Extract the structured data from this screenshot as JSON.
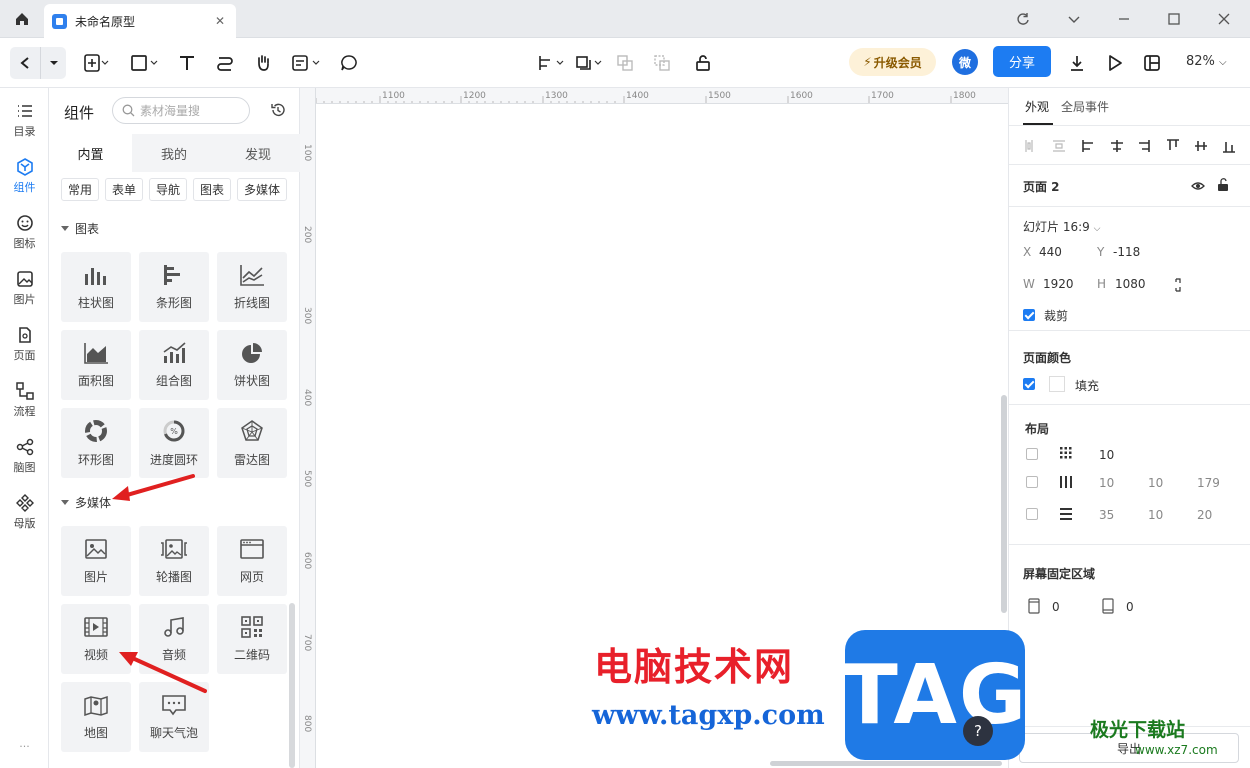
{
  "titlebar": {
    "tab_title": "未命名原型"
  },
  "toolbar": {
    "upgrade": "升级会员",
    "avatar": "微",
    "share": "分享",
    "zoom": "82%"
  },
  "rail": [
    {
      "label": "目录",
      "icon": "list-icon"
    },
    {
      "label": "组件",
      "icon": "component-icon"
    },
    {
      "label": "图标",
      "icon": "smile-icon"
    },
    {
      "label": "图片",
      "icon": "image-icon"
    },
    {
      "label": "页面",
      "icon": "page-icon"
    },
    {
      "label": "流程",
      "icon": "flow-icon"
    },
    {
      "label": "脑图",
      "icon": "mindmap-icon"
    },
    {
      "label": "母版",
      "icon": "master-icon"
    }
  ],
  "rail_more": "...",
  "panel": {
    "title": "组件",
    "search_placeholder": "素材海量搜",
    "tabs": [
      "内置",
      "我的",
      "发现"
    ],
    "chips": [
      "常用",
      "表单",
      "导航",
      "图表",
      "多媒体"
    ],
    "section_chart": "图表",
    "chart_items": [
      "柱状图",
      "条形图",
      "折线图",
      "面积图",
      "组合图",
      "饼状图",
      "环形图",
      "进度圆环",
      "雷达图"
    ],
    "section_media": "多媒体",
    "media_items": [
      "图片",
      "轮播图",
      "网页",
      "视频",
      "音频",
      "二维码",
      "地图",
      "聊天气泡"
    ]
  },
  "ruler": {
    "h": [
      "1100",
      "1200",
      "1300",
      "1400",
      "1500",
      "1600",
      "1700",
      "1800"
    ],
    "v": [
      "100",
      "200",
      "300",
      "400",
      "500",
      "600",
      "700",
      "800"
    ]
  },
  "right": {
    "tabs": [
      "外观",
      "全局事件"
    ],
    "page_name": "页面 2",
    "preset": "幻灯片 16:9",
    "x_label": "X",
    "x": "440",
    "y_label": "Y",
    "y": "-118",
    "w_label": "W",
    "w": "1920",
    "h_label": "H",
    "h": "1080",
    "crop": "裁剪",
    "page_color": "页面颜色",
    "fill": "填充",
    "layout": "布局",
    "grid_val": "10",
    "col_vals": [
      "10",
      "10",
      "179"
    ],
    "row_vals": [
      "35",
      "10",
      "20"
    ],
    "fixed_area": "屏幕固定区域",
    "fixed_top": "0",
    "fixed_bottom": "0",
    "export": "导出"
  },
  "watermark": {
    "line1": "电脑技术网",
    "line2": "www.tagxp.com",
    "tag": "TAG",
    "brand": "极光下载站",
    "brand_url": "www.xz7.com"
  },
  "help": "?",
  "colors": {
    "accent": "#1d7cf2",
    "arrow": "#e02020"
  }
}
